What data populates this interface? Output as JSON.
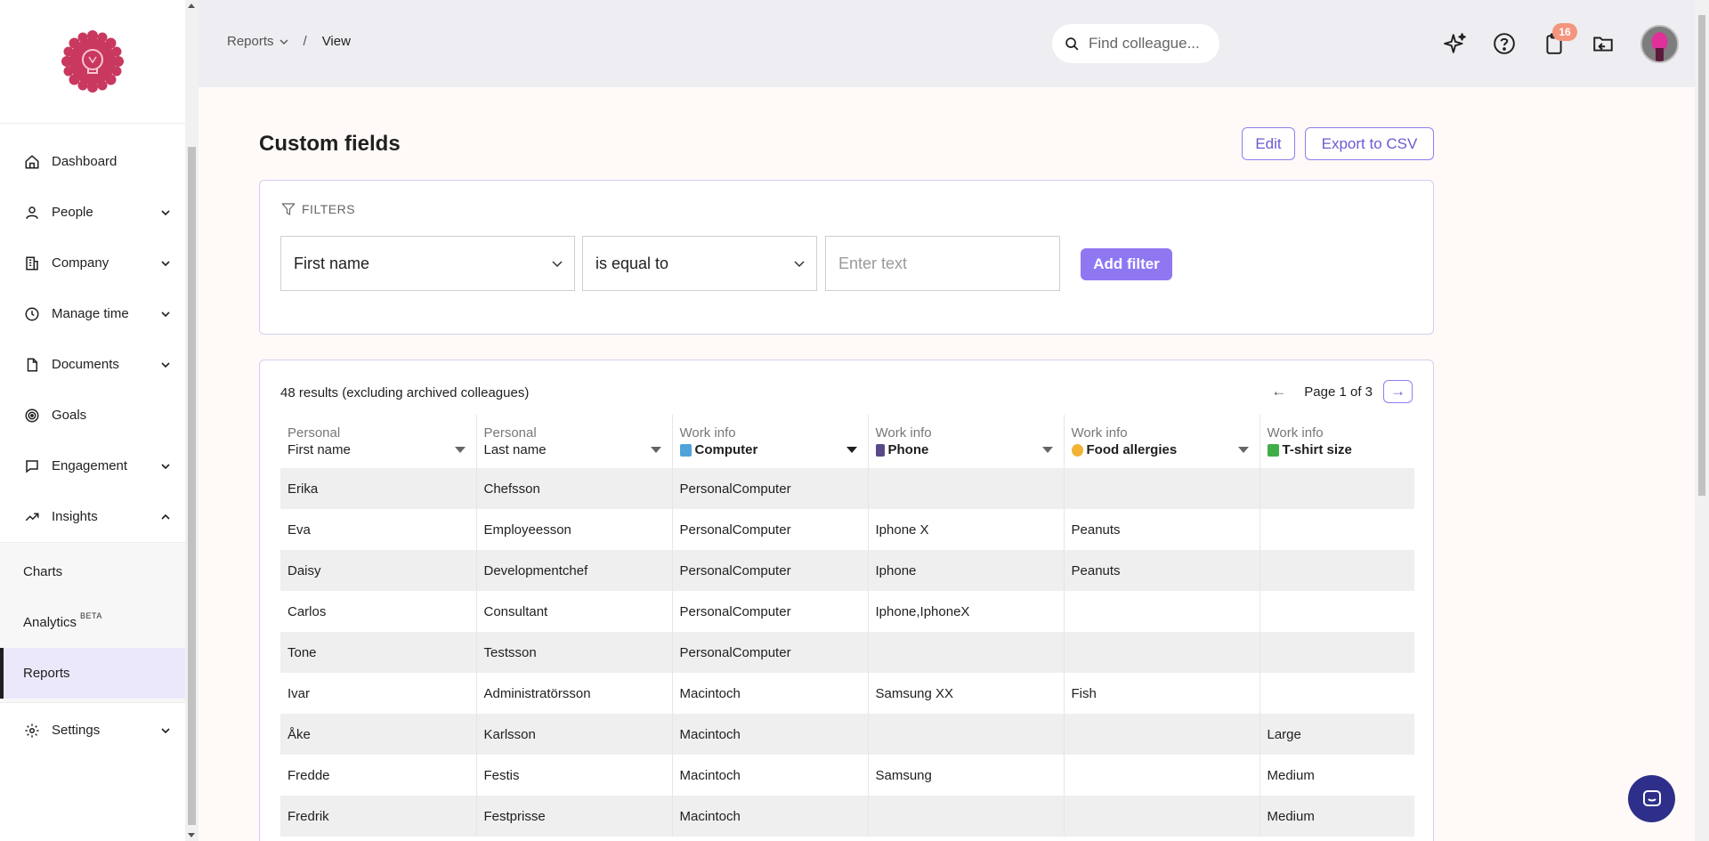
{
  "sidebar": {
    "logo": "company-logo",
    "items": [
      {
        "label": "Dashboard",
        "icon": "home-icon"
      },
      {
        "label": "People",
        "icon": "user-icon"
      },
      {
        "label": "Company",
        "icon": "building-icon"
      },
      {
        "label": "Manage time",
        "icon": "clock-icon"
      },
      {
        "label": "Documents",
        "icon": "document-icon"
      },
      {
        "label": "Goals",
        "icon": "target-icon"
      },
      {
        "label": "Engagement",
        "icon": "chat-icon"
      },
      {
        "label": "Insights",
        "icon": "trend-icon"
      }
    ],
    "insights_sub": [
      {
        "label": "Charts"
      },
      {
        "label": "Analytics",
        "badge": "BETA"
      },
      {
        "label": "Reports"
      }
    ],
    "settings": {
      "label": "Settings",
      "icon": "gear-icon"
    }
  },
  "topbar": {
    "breadcrumb": {
      "parent": "Reports",
      "separator": "/",
      "current": "View"
    },
    "search": {
      "placeholder": "Find colleague..."
    },
    "notification_count": "16"
  },
  "page": {
    "title": "Custom fields",
    "edit_label": "Edit",
    "export_label": "Export to CSV"
  },
  "filters": {
    "heading": "FILTERS",
    "field_value": "First name",
    "operator_value": "is equal to",
    "text_placeholder": "Enter text",
    "add_label": "Add filter"
  },
  "results": {
    "count_text": "48 results (excluding archived colleagues)",
    "page_text": "Page 1 of 3",
    "prev": "←",
    "next": "→",
    "columns": [
      {
        "group": "Personal",
        "field": "First name"
      },
      {
        "group": "Personal",
        "field": "Last name"
      },
      {
        "group": "Work info",
        "field": "Computer",
        "emoji": "computer-emoji"
      },
      {
        "group": "Work info",
        "field": "Phone",
        "emoji": "phone-emoji"
      },
      {
        "group": "Work info",
        "field": "Food allergies",
        "emoji": "allergy-face-emoji"
      },
      {
        "group": "Work info",
        "field": "T-shirt size",
        "emoji": "tshirt-emoji"
      }
    ],
    "rows": [
      [
        "Erika",
        "Chefsson",
        "PersonalComputer",
        "",
        "",
        ""
      ],
      [
        "Eva",
        "Employeesson",
        "PersonalComputer",
        "Iphone X",
        "Peanuts",
        ""
      ],
      [
        "Daisy",
        "Developmentchef",
        "PersonalComputer",
        "Iphone",
        "Peanuts",
        ""
      ],
      [
        "Carlos",
        "Consultant",
        "PersonalComputer",
        "Iphone,IphoneX",
        "",
        ""
      ],
      [
        "Tone",
        "Testsson",
        "PersonalComputer",
        "",
        "",
        ""
      ],
      [
        "Ivar",
        "Administratörsson",
        "Macintoch",
        "Samsung XX",
        "Fish",
        ""
      ],
      [
        "Åke",
        "Karlsson",
        "Macintoch",
        "",
        "",
        "Large"
      ],
      [
        "Fredde",
        "Festis",
        "Macintoch",
        "Samsung",
        "",
        "Medium"
      ],
      [
        "Fredrik",
        "Festprisse",
        "Macintoch",
        "",
        "",
        "Medium"
      ]
    ]
  },
  "colors": {
    "accent": "#9077f2",
    "accent_border": "#8f7ff0",
    "badge": "#f4957d",
    "logo": "#c9385f",
    "chat_button": "#2e2f8a"
  }
}
